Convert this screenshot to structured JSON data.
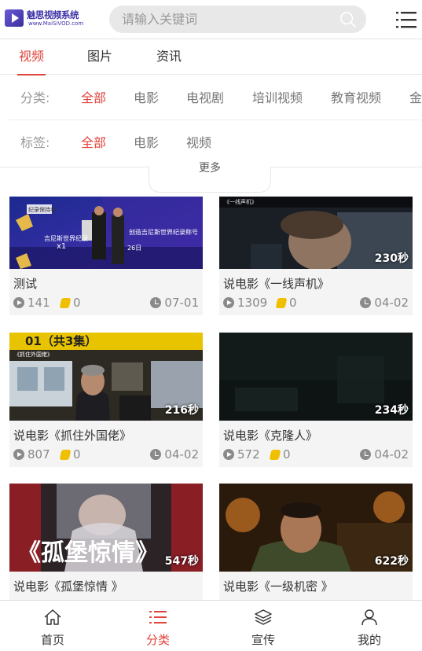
{
  "header": {
    "logo_name": "魅思视频系统",
    "logo_url": "www.MaiSiVOD.com",
    "search_placeholder": "请输入关键词"
  },
  "tabs": [
    {
      "label": "视频",
      "active": true
    },
    {
      "label": "图片",
      "active": false
    },
    {
      "label": "资讯",
      "active": false
    }
  ],
  "filters": {
    "category": {
      "label": "分类:",
      "items": [
        {
          "label": "全部",
          "active": true
        },
        {
          "label": "电影",
          "active": false
        },
        {
          "label": "电视剧",
          "active": false
        },
        {
          "label": "培训视频",
          "active": false
        },
        {
          "label": "教育视频",
          "active": false
        },
        {
          "label": "金",
          "active": false
        }
      ]
    },
    "tag": {
      "label": "标签:",
      "items": [
        {
          "label": "全部",
          "active": true
        },
        {
          "label": "电影",
          "active": false
        },
        {
          "label": "视频",
          "active": false
        }
      ]
    },
    "more_label": "更多"
  },
  "videos": [
    {
      "title": "测试",
      "views": "141",
      "coins": "0",
      "date": "07-01",
      "duration": ""
    },
    {
      "title": "说电影《一线声机》",
      "views": "1309",
      "coins": "0",
      "date": "04-02",
      "duration": "230秒"
    },
    {
      "title": "说电影《抓住外国佬》",
      "views": "807",
      "coins": "0",
      "date": "04-02",
      "duration": "216秒"
    },
    {
      "title": "说电影《克隆人》",
      "views": "572",
      "coins": "0",
      "date": "04-02",
      "duration": "234秒"
    },
    {
      "title": "说电影《孤堡惊情 》",
      "views": "",
      "coins": "",
      "date": "",
      "duration": "547秒"
    },
    {
      "title": "说电影《一级机密 》",
      "views": "",
      "coins": "",
      "date": "",
      "duration": "622秒"
    }
  ],
  "thumb_text": {
    "t1_badge": "纪录保持者",
    "t1_line1": "吉尼斯世界纪录",
    "t1_cert": "创造吉尼斯世界纪录称号",
    "t1_mult": "x1",
    "t1_date": "26日",
    "t2_tag": "《一线声机》",
    "t3_banner": "01（共3集）",
    "t3_tag": "《抓住外国佬》",
    "t5_title": "《孤堡惊情》"
  },
  "bottom_nav": [
    {
      "label": "首页",
      "icon": "home-icon",
      "active": false
    },
    {
      "label": "分类",
      "icon": "list-icon",
      "active": true
    },
    {
      "label": "宣传",
      "icon": "layers-icon",
      "active": false
    },
    {
      "label": "我的",
      "icon": "user-icon",
      "active": false
    }
  ],
  "colors": {
    "accent": "#e0433b",
    "brand": "#3d33a8"
  }
}
